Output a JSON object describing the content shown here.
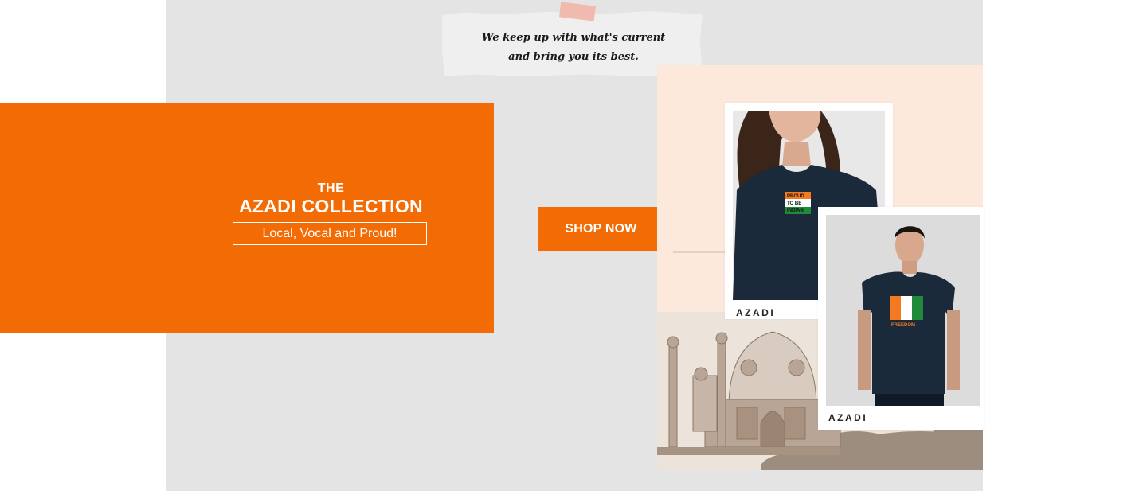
{
  "note": {
    "line1": "We keep up with what's current",
    "line2": "and bring you its best."
  },
  "hero": {
    "eyebrow": "THE",
    "title": "AZADI COLLECTION",
    "tagline": "Local, Vocal and Proud!"
  },
  "cta": {
    "label": "SHOP NOW"
  },
  "products": [
    {
      "label": "AZADI",
      "print_text": "PROUD TO BE INDIAN"
    },
    {
      "label": "AZADI",
      "print_text": "FREEDOM"
    }
  ],
  "colors": {
    "accent": "#f36b05",
    "panel_grey": "#e4e4e4",
    "peach": "#fde9dc",
    "tshirt_navy": "#1b2a3b",
    "saffron": "#f37a21",
    "green": "#1f8a3a"
  },
  "icons": [
    "tape-strip-icon",
    "monument-illustration-icon"
  ]
}
